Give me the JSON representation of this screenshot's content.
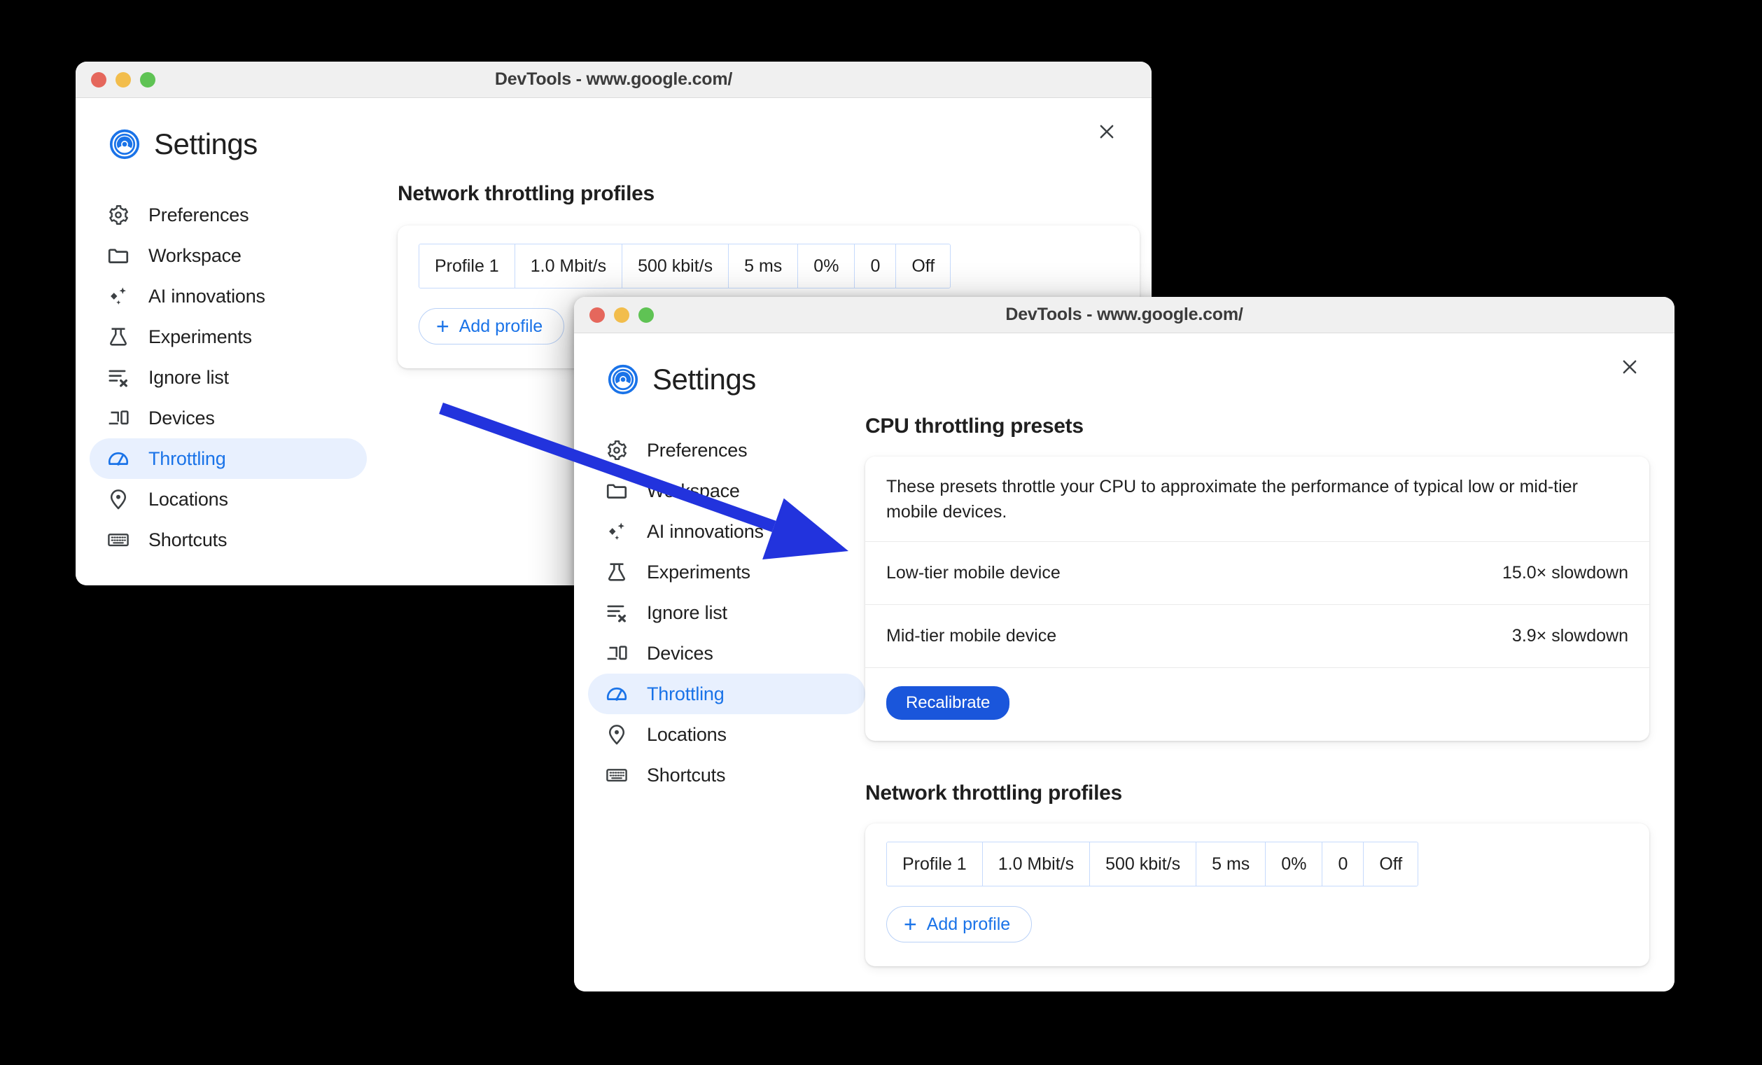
{
  "windows": {
    "back": {
      "title": "DevTools - www.google.com/",
      "app_name": "Settings",
      "close_icon": "close-icon",
      "logo_icon": "chrome-logo-icon",
      "sidebar": [
        {
          "label": "Preferences",
          "icon": "gear-icon",
          "active": false
        },
        {
          "label": "Workspace",
          "icon": "folder-icon",
          "active": false
        },
        {
          "label": "AI innovations",
          "icon": "sparkle-icon",
          "active": false
        },
        {
          "label": "Experiments",
          "icon": "flask-icon",
          "active": false
        },
        {
          "label": "Ignore list",
          "icon": "list-x-icon",
          "active": false
        },
        {
          "label": "Devices",
          "icon": "devices-icon",
          "active": false
        },
        {
          "label": "Throttling",
          "icon": "speedometer-icon",
          "active": true
        },
        {
          "label": "Locations",
          "icon": "location-pin-icon",
          "active": false
        },
        {
          "label": "Shortcuts",
          "icon": "keyboard-icon",
          "active": false
        }
      ],
      "network": {
        "heading": "Network throttling profiles",
        "row": [
          "Profile 1",
          "1.0 Mbit/s",
          "500 kbit/s",
          "5 ms",
          "0%",
          "0",
          "Off"
        ],
        "add_label": "Add profile",
        "add_plus": "+"
      }
    },
    "front": {
      "title": "DevTools - www.google.com/",
      "app_name": "Settings",
      "close_icon": "close-icon",
      "logo_icon": "chrome-logo-icon",
      "sidebar": [
        {
          "label": "Preferences",
          "icon": "gear-icon",
          "active": false
        },
        {
          "label": "Workspace",
          "icon": "folder-icon",
          "active": false
        },
        {
          "label": "AI innovations",
          "icon": "sparkle-icon",
          "active": false
        },
        {
          "label": "Experiments",
          "icon": "flask-icon",
          "active": false
        },
        {
          "label": "Ignore list",
          "icon": "list-x-icon",
          "active": false
        },
        {
          "label": "Devices",
          "icon": "devices-icon",
          "active": false
        },
        {
          "label": "Throttling",
          "icon": "speedometer-icon",
          "active": true
        },
        {
          "label": "Locations",
          "icon": "location-pin-icon",
          "active": false
        },
        {
          "label": "Shortcuts",
          "icon": "keyboard-icon",
          "active": false
        }
      ],
      "cpu": {
        "heading": "CPU throttling presets",
        "description": "These presets throttle your CPU to approximate the performance of typical low or mid-tier mobile devices.",
        "presets": [
          {
            "name": "Low-tier mobile device",
            "value": "15.0× slowdown"
          },
          {
            "name": "Mid-tier mobile device",
            "value": "3.9× slowdown"
          }
        ],
        "recalibrate_label": "Recalibrate"
      },
      "network": {
        "heading": "Network throttling profiles",
        "row": [
          "Profile 1",
          "1.0 Mbit/s",
          "500 kbit/s",
          "5 ms",
          "0%",
          "0",
          "Off"
        ],
        "add_label": "Add profile",
        "add_plus": "+"
      }
    }
  },
  "annotation": {
    "name": "blue-pointer-arrow",
    "color": "#2233dd"
  },
  "colors": {
    "accent_blue": "#1a73e8",
    "button_blue": "#1a56db",
    "active_bg": "#e8f0fe",
    "traffic_red": "#e5675c",
    "traffic_yellow": "#f2bd4c",
    "traffic_green": "#5fc354",
    "table_border": "#c6dafc",
    "desktop": "#000000"
  }
}
